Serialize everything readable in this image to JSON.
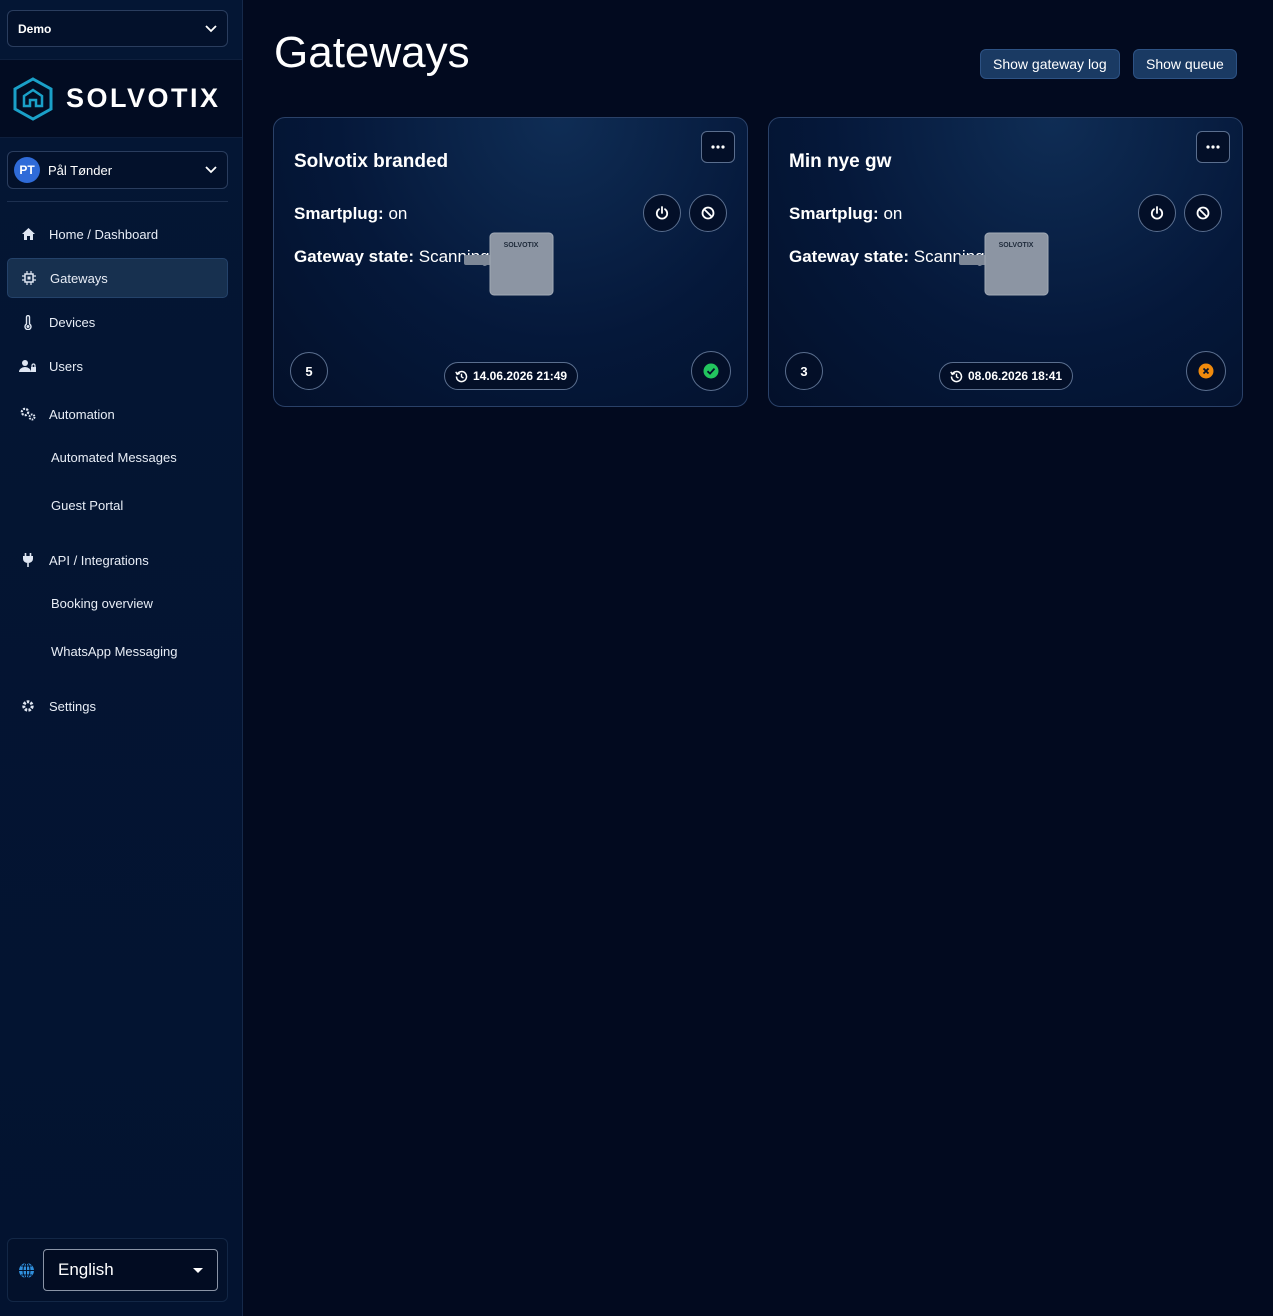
{
  "sidebar": {
    "org_select": "Demo",
    "logo_text": "SOLVOTIX",
    "user": {
      "initials": "PT",
      "name": "Pål Tønder"
    },
    "nav": {
      "home": "Home / Dashboard",
      "gateways": "Gateways",
      "devices": "Devices",
      "users": "Users",
      "automation": "Automation",
      "automated_messages": "Automated Messages",
      "guest_portal": "Guest Portal",
      "api": "API / Integrations",
      "booking_overview": "Booking overview",
      "whatsapp": "WhatsApp Messaging",
      "settings": "Settings"
    },
    "language": "English"
  },
  "main": {
    "title": "Gateways",
    "buttons": {
      "gateway_log": "Show gateway log",
      "queue": "Show queue"
    },
    "smartplug_label": "Smartplug:",
    "state_label": "Gateway state:",
    "device_brand": "SOLVOTIX",
    "cards": [
      {
        "name": "Solvotix branded",
        "smartplug": "on",
        "state": "Scanning",
        "count": "5",
        "timestamp": "14.06.2026 21:49",
        "status": "ok",
        "status_color": "#22c55e"
      },
      {
        "name": "Min nye gw",
        "smartplug": "on",
        "state": "Scanning",
        "count": "3",
        "timestamp": "08.06.2026 18:41",
        "status": "error",
        "status_color": "#f08a0c"
      }
    ]
  }
}
